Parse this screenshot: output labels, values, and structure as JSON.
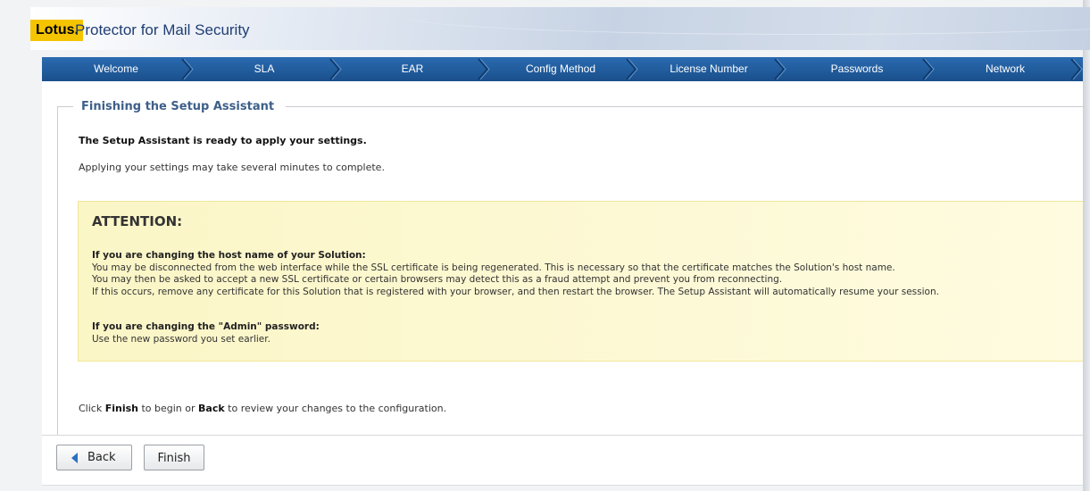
{
  "app": {
    "brand": "Lotus.",
    "title": "Protector for Mail Security"
  },
  "nav": {
    "items": [
      {
        "label": "Welcome"
      },
      {
        "label": "SLA"
      },
      {
        "label": "EAR"
      },
      {
        "label": "Config Method"
      },
      {
        "label": "License Number"
      },
      {
        "label": "Passwords"
      },
      {
        "label": "Network"
      }
    ]
  },
  "page": {
    "section_title": "Finishing the Setup Assistant",
    "ready_text": "The Setup Assistant is ready to apply your settings.",
    "duration_text": "Applying your settings may take several minutes to complete."
  },
  "attention": {
    "title": "ATTENTION:",
    "host_heading": "If you are changing the host name of your Solution:",
    "host_line1": "You may be disconnected from the web interface while the SSL certificate is being regenerated. This is necessary so that the certificate matches the Solution's host name.",
    "host_line2": "You may then be asked to accept a new SSL certificate or certain browsers may detect this as a fraud attempt and prevent you from reconnecting.",
    "host_line3": "If this occurs, remove any certificate for this Solution that is registered with your browser, and then restart the browser. The Setup Assistant will automatically resume your session.",
    "admin_heading": "If you are changing the \"Admin\" password:",
    "admin_line1": "Use the new password you set earlier."
  },
  "footer": {
    "text_pre": "Click ",
    "finish_word": "Finish",
    "text_mid": " to begin or ",
    "back_word": "Back",
    "text_post": " to review your changes to the configuration."
  },
  "buttons": {
    "back": "Back",
    "finish": "Finish"
  },
  "colors": {
    "brand_yellow": "#f5c400",
    "nav_blue": "#1f5c9e",
    "title_blue": "#3e5f8a",
    "attention_bg": "#fbf6c6"
  },
  "icons": {
    "back_arrow": "left-arrow-icon",
    "nav_separator": "chevron-right-icon"
  }
}
